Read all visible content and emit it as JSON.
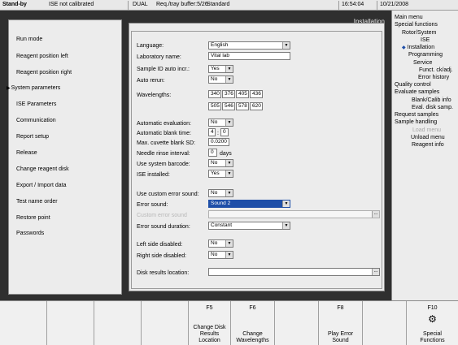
{
  "status": {
    "mode": "Stand-by",
    "ise": "ISE not calibrated",
    "dual": "DUAL",
    "buffer": "Req./tray buffer:5/26",
    "standard": "Standard",
    "time": "16:54:04",
    "date": "10/21/2008"
  },
  "header": {
    "title": "Installation"
  },
  "left_menu": {
    "items": [
      "Run mode",
      "Reagent position left",
      "Reagent position right",
      "System parameters",
      "ISE Parameters",
      "Communication",
      "Report setup",
      "Release",
      "Change reagent disk",
      "Export / Import data",
      "Test name order",
      "Restore point",
      "Passwords"
    ],
    "active": "System parameters"
  },
  "form": {
    "language_label": "Language:",
    "language": "English",
    "lab_name_label": "Laboratory name:",
    "lab_name": "Vital lab",
    "sample_id_label": "Sample ID auto incr.:",
    "sample_id": "Yes",
    "auto_rerun_label": "Auto rerun:",
    "auto_rerun": "No",
    "wavelengths_label": "Wavelengths:",
    "wavelengths": [
      "340",
      "376",
      "405",
      "436",
      "505",
      "546",
      "578",
      "620"
    ],
    "auto_eval_label": "Automatic evaluation:",
    "auto_eval": "No",
    "blank_time_label": "Automatic blank time:",
    "blank_time_h": "4",
    "blank_time_sep": ":",
    "blank_time_m": "0",
    "max_cuvette_label": "Max. cuvette blank SD:",
    "max_cuvette": "0.0200",
    "needle_label": "Needle rinse interval:",
    "needle": "0",
    "needle_unit": "days",
    "barcode_label": "Use system barcode:",
    "barcode": "No",
    "ise_label": "ISE installed:",
    "ise": "Yes",
    "custom_sound_label": "Use custom error sound:",
    "custom_sound": "No",
    "error_sound_label": "Error sound:",
    "error_sound": "Sound 2",
    "custom_error_sound_label": "Custom error sound",
    "custom_error_sound": "",
    "sound_duration_label": "Error sound duration:",
    "sound_duration": "Constant",
    "left_side_label": "Left side disabled:",
    "left_side": "No",
    "right_side_label": "Right side disabled:",
    "right_side": "No",
    "disk_results_label": "Disk results location:",
    "disk_results": "",
    "dots": "..."
  },
  "right_menu": {
    "items": [
      "Main menu",
      "Special functions",
      "Rotor/System",
      "ISE",
      "Installation",
      "Programming",
      "Service",
      "Funct. ck/adj.",
      "Error history",
      "Quality control",
      "Evaluate samples",
      "Blank/Calib info",
      "Eval. disk samp.",
      "Request samples",
      "Sample handling",
      "Load menu",
      "Unload menu",
      "Reagent info"
    ],
    "active": "Installation",
    "disabled": [
      "Load menu"
    ]
  },
  "fkeys": [
    {
      "key": "F5",
      "label": "Change Disk\nResults\nLocation"
    },
    {
      "key": "F6",
      "label": "Change\nWavelengths"
    },
    {
      "key": "F8",
      "label": "Play Error\nSound"
    },
    {
      "key": "F10",
      "label": "Special\nFunctions",
      "icon": "gears-icon"
    }
  ]
}
